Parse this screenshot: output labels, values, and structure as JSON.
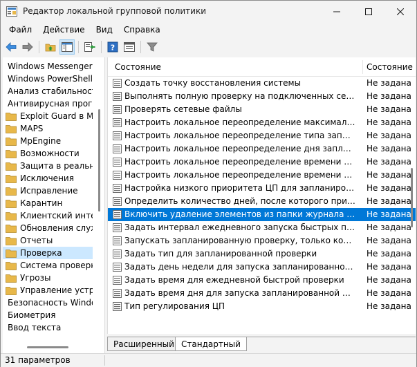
{
  "window": {
    "title": "Редактор локальной групповой политики"
  },
  "menu": [
    "Файл",
    "Действие",
    "Вид",
    "Справка"
  ],
  "toolbar": {
    "icons": [
      "back-arrow-icon",
      "forward-arrow-icon",
      "folder-up-icon",
      "show-hide-tree-icon",
      "export-list-icon",
      "help-icon",
      "properties-icon",
      "filter-icon"
    ]
  },
  "tree": {
    "items": [
      {
        "label": "Windows Messenger",
        "folder": false
      },
      {
        "label": "Windows PowerShell",
        "folder": false
      },
      {
        "label": "Анализ стабильности",
        "folder": false
      },
      {
        "label": "Антивирусная програм",
        "folder": false
      },
      {
        "label": "Exploit Guard в Mic",
        "folder": true
      },
      {
        "label": "MAPS",
        "folder": true
      },
      {
        "label": "MpEngine",
        "folder": true
      },
      {
        "label": "Возможности",
        "folder": true
      },
      {
        "label": "Защита в реальном",
        "folder": true
      },
      {
        "label": "Исключения",
        "folder": true
      },
      {
        "label": "Исправление",
        "folder": true
      },
      {
        "label": "Карантин",
        "folder": true
      },
      {
        "label": "Клиентский интерс",
        "folder": true
      },
      {
        "label": "Обновления служб",
        "folder": true
      },
      {
        "label": "Отчеты",
        "folder": true
      },
      {
        "label": "Проверка",
        "folder": true,
        "selected": true
      },
      {
        "label": "Система проверки",
        "folder": true
      },
      {
        "label": "Угрозы",
        "folder": true
      },
      {
        "label": "Управление устрой",
        "folder": true
      },
      {
        "label": "Безопасность Window",
        "folder": false
      },
      {
        "label": "Биометрия",
        "folder": false
      },
      {
        "label": "Ввод текста",
        "folder": false
      }
    ]
  },
  "list": {
    "columns": [
      "Состояние",
      "Состояние"
    ],
    "rows": [
      {
        "name": "Создать точку восстановления системы",
        "state": "Не задана"
      },
      {
        "name": "Выполнять полную проверку на подключенных сетевых ...",
        "state": "Не задана"
      },
      {
        "name": "Проверять сетевые файлы",
        "state": "Не задана"
      },
      {
        "name": "Настроить локальное переопределение максимального ...",
        "state": "Не задана"
      },
      {
        "name": "Настроить локальное переопределение типа запланиров...",
        "state": "Не задана"
      },
      {
        "name": "Настроить локальное переопределение дня запланирова...",
        "state": "Не задана"
      },
      {
        "name": "Настроить локальное переопределение времени заплан...",
        "state": "Не задана"
      },
      {
        "name": "Настроить локальное переопределение времени заплан...",
        "state": "Не задана"
      },
      {
        "name": "Настройка низкого приоритета ЦП для запланированны...",
        "state": "Не задана"
      },
      {
        "name": "Определить количество дней, после которого принудите...",
        "state": "Не задана"
      },
      {
        "name": "Включить удаление элементов из папки журнала провер...",
        "state": "Не задана",
        "selected": true
      },
      {
        "name": "Задать интервал ежедневного запуска быстрых проверок",
        "state": "Не задана"
      },
      {
        "name": "Запускать запланированную проверку, только когда ком...",
        "state": "Не задана"
      },
      {
        "name": "Задать тип для запланированной проверки",
        "state": "Не задана"
      },
      {
        "name": "Задать день недели для запуска запланированной прове...",
        "state": "Не задана"
      },
      {
        "name": "Задать время для ежедневной быстрой проверки",
        "state": "Не задана"
      },
      {
        "name": "Задать время дня для запуска запланированной провер...",
        "state": "Не задана"
      },
      {
        "name": "Тип регулирования ЦП",
        "state": "Не задана"
      }
    ]
  },
  "tabs": [
    "Расширенный",
    "Стандартный"
  ],
  "status": {
    "text": "31 параметров"
  },
  "colors": {
    "selection": "#0078d7",
    "tree_selection": "#cce8ff",
    "folder": "#e8b84a"
  }
}
